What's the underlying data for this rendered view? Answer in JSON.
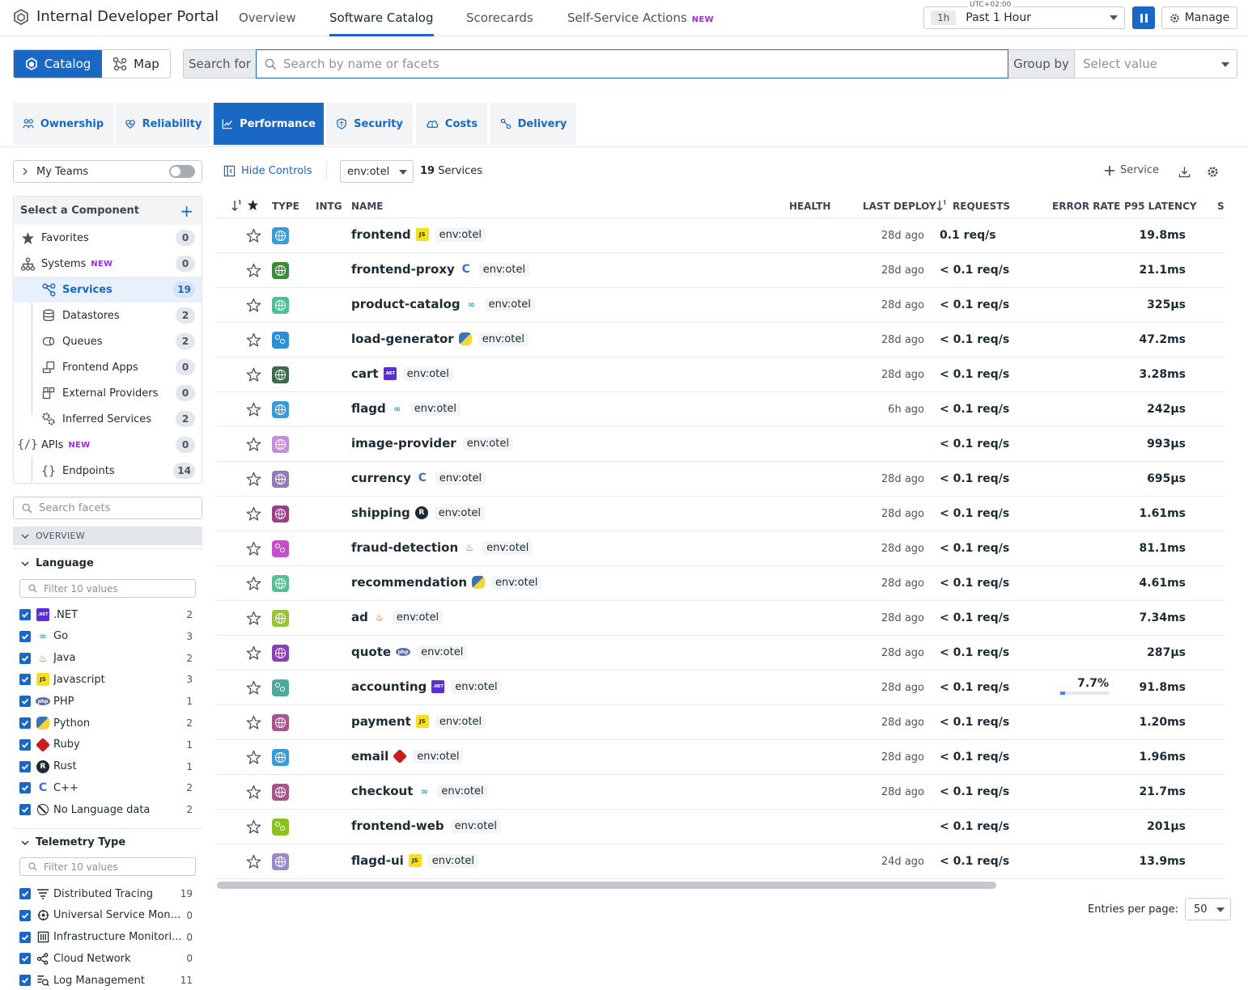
{
  "app": {
    "title": "Internal Developer Portal"
  },
  "nav": {
    "tabs": [
      {
        "label": "Overview"
      },
      {
        "label": "Software Catalog",
        "active": true
      },
      {
        "label": "Scorecards"
      },
      {
        "label": "Self-Service Actions",
        "badge": "NEW"
      }
    ],
    "timezone": "UTC+02:00",
    "time_chip": "1h",
    "time_label": "Past 1 Hour",
    "manage_label": "Manage"
  },
  "view_toggle": {
    "catalog": "Catalog",
    "map": "Map"
  },
  "search": {
    "prefix": "Search for",
    "placeholder": "Search by name or facets",
    "group_label": "Group by",
    "group_placeholder": "Select value"
  },
  "lenses": [
    {
      "label": "Ownership",
      "icon": "people-icon"
    },
    {
      "label": "Reliability",
      "icon": "heart-shield-icon"
    },
    {
      "label": "Performance",
      "icon": "line-chart-icon",
      "active": true
    },
    {
      "label": "Security",
      "icon": "shield-icon"
    },
    {
      "label": "Costs",
      "icon": "cloud-dollar-icon"
    },
    {
      "label": "Delivery",
      "icon": "pipeline-icon"
    }
  ],
  "sidebar": {
    "my_teams": "My Teams",
    "component_header": "Select a Component",
    "components": [
      {
        "label": "Favorites",
        "count": "0",
        "icon": "star-icon"
      },
      {
        "label": "Systems",
        "badge": "NEW",
        "count": "0",
        "icon": "systems-icon"
      },
      {
        "label": "Services",
        "count": "19",
        "icon": "services-icon",
        "selected": true,
        "child": true
      },
      {
        "label": "Datastores",
        "count": "2",
        "icon": "database-icon",
        "child": true
      },
      {
        "label": "Queues",
        "count": "2",
        "icon": "queue-icon",
        "child": true
      },
      {
        "label": "Frontend Apps",
        "count": "0",
        "icon": "frontend-app-icon",
        "child": true
      },
      {
        "label": "External Providers",
        "count": "0",
        "icon": "external-provider-icon",
        "child": true
      },
      {
        "label": "Inferred Services",
        "count": "2",
        "icon": "inferred-service-icon",
        "child": true
      },
      {
        "label": "APIs",
        "badge": "NEW",
        "count": "0",
        "icon": "api-icon"
      },
      {
        "label": "Endpoints",
        "count": "14",
        "icon": "braces-icon",
        "child": true
      }
    ],
    "facet_search_placeholder": "Search facets",
    "overview_label": "OVERVIEW",
    "language": {
      "title": "Language",
      "filter_placeholder": "Filter 10 values",
      "values": [
        {
          "label": ".NET",
          "count": "2",
          "badge": "net"
        },
        {
          "label": "Go",
          "count": "3",
          "badge": "go"
        },
        {
          "label": "Java",
          "count": "2",
          "badge": "java"
        },
        {
          "label": "Javascript",
          "count": "3",
          "badge": "js"
        },
        {
          "label": "PHP",
          "count": "1",
          "badge": "php"
        },
        {
          "label": "Python",
          "count": "2",
          "badge": "py"
        },
        {
          "label": "Ruby",
          "count": "1",
          "badge": "ruby"
        },
        {
          "label": "Rust",
          "count": "1",
          "badge": "rust"
        },
        {
          "label": "C++",
          "count": "2",
          "badge": "cpp"
        },
        {
          "label": "No Language data",
          "count": "2",
          "badge": "none"
        }
      ]
    },
    "telemetry": {
      "title": "Telemetry Type",
      "filter_placeholder": "Filter 10 values",
      "values": [
        {
          "label": "Distributed Tracing",
          "count": "19",
          "icon": "tracing-icon"
        },
        {
          "label": "Universal Service Monit...",
          "count": "0",
          "icon": "usm-icon"
        },
        {
          "label": "Infrastructure Monitori...",
          "count": "0",
          "icon": "infrastructure-icon"
        },
        {
          "label": "Cloud Network",
          "count": "0",
          "icon": "network-icon"
        },
        {
          "label": "Log Management",
          "count": "11",
          "icon": "logs-icon"
        }
      ]
    }
  },
  "controls": {
    "hide_controls": "Hide Controls",
    "env": "env:otel",
    "service_count": "19",
    "service_count_suffix": "Services",
    "add_service": "Service"
  },
  "table": {
    "columns": {
      "type": "TYPE",
      "intg": "INTG",
      "name": "NAME",
      "health": "HEALTH",
      "last_deploy": "LAST DEPLOY",
      "requests": "REQUESTS",
      "error_rate": "ERROR RATE",
      "p95": "P95 LATENCY",
      "cut": "SI"
    },
    "rows": [
      {
        "name": "frontend",
        "lang": "js",
        "env": "env:otel",
        "deploy": "28d ago",
        "requests": "0.1 req/s",
        "error": "",
        "latency": "19.8ms",
        "color": "#3b9bd6",
        "icon": "globe"
      },
      {
        "name": "frontend-proxy",
        "lang": "cpp",
        "env": "env:otel",
        "deploy": "28d ago",
        "requests": "< 0.1 req/s",
        "error": "",
        "latency": "21.1ms",
        "color": "#3f8a3a",
        "icon": "globe"
      },
      {
        "name": "product-catalog",
        "lang": "go",
        "env": "env:otel",
        "deploy": "28d ago",
        "requests": "< 0.1 req/s",
        "error": "",
        "latency": "325µs",
        "color": "#4fbf9a",
        "icon": "globe"
      },
      {
        "name": "load-generator",
        "lang": "py",
        "env": "env:otel",
        "deploy": "28d ago",
        "requests": "< 0.1 req/s",
        "error": "",
        "latency": "47.2ms",
        "color": "#2e8fd6",
        "icon": "cog"
      },
      {
        "name": "cart",
        "lang": "net",
        "env": "env:otel",
        "deploy": "28d ago",
        "requests": "< 0.1 req/s",
        "error": "",
        "latency": "3.28ms",
        "color": "#3e6b4c",
        "icon": "globe"
      },
      {
        "name": "flagd",
        "lang": "go",
        "env": "env:otel",
        "deploy": "6h ago",
        "requests": "< 0.1 req/s",
        "error": "",
        "latency": "242µs",
        "color": "#3b9bd6",
        "icon": "globe"
      },
      {
        "name": "image-provider",
        "lang": "",
        "env": "env:otel",
        "deploy": "",
        "requests": "< 0.1 req/s",
        "error": "",
        "latency": "993µs",
        "color": "#c48fd9",
        "icon": "globe"
      },
      {
        "name": "currency",
        "lang": "cpp",
        "env": "env:otel",
        "deploy": "28d ago",
        "requests": "< 0.1 req/s",
        "error": "",
        "latency": "695µs",
        "color": "#8f7bb8",
        "icon": "globe"
      },
      {
        "name": "shipping",
        "lang": "rust",
        "env": "env:otel",
        "deploy": "28d ago",
        "requests": "< 0.1 req/s",
        "error": "",
        "latency": "1.61ms",
        "color": "#9a3e8a",
        "icon": "globe"
      },
      {
        "name": "fraud-detection",
        "lang": "java",
        "env": "env:otel",
        "deploy": "28d ago",
        "requests": "< 0.1 req/s",
        "error": "",
        "latency": "81.1ms",
        "color": "#c44fc7",
        "icon": "cog"
      },
      {
        "name": "recommendation",
        "lang": "py",
        "env": "env:otel",
        "deploy": "28d ago",
        "requests": "< 0.1 req/s",
        "error": "",
        "latency": "4.61ms",
        "color": "#58bf96",
        "icon": "globe"
      },
      {
        "name": "ad",
        "lang": "java",
        "env": "env:otel",
        "deploy": "28d ago",
        "requests": "< 0.1 req/s",
        "error": "",
        "latency": "7.34ms",
        "color": "#9ac23a",
        "icon": "globe"
      },
      {
        "name": "quote",
        "lang": "php",
        "env": "env:otel",
        "deploy": "28d ago",
        "requests": "< 0.1 req/s",
        "error": "",
        "latency": "287µs",
        "color": "#8a3eb8",
        "icon": "globe"
      },
      {
        "name": "accounting",
        "lang": "net",
        "env": "env:otel",
        "deploy": "28d ago",
        "requests": "< 0.1 req/s",
        "error": "7.7%",
        "error_fraction": 0.1,
        "latency": "91.8ms",
        "color": "#4fa89a",
        "icon": "cog"
      },
      {
        "name": "payment",
        "lang": "js",
        "env": "env:otel",
        "deploy": "28d ago",
        "requests": "< 0.1 req/s",
        "error": "",
        "latency": "1.20ms",
        "color": "#a8558e",
        "icon": "globe"
      },
      {
        "name": "email",
        "lang": "ruby",
        "env": "env:otel",
        "deploy": "28d ago",
        "requests": "< 0.1 req/s",
        "error": "",
        "latency": "1.96ms",
        "color": "#3b9bd6",
        "icon": "globe"
      },
      {
        "name": "checkout",
        "lang": "go",
        "env": "env:otel",
        "deploy": "28d ago",
        "requests": "< 0.1 req/s",
        "error": "",
        "latency": "21.7ms",
        "color": "#a8558e",
        "icon": "globe"
      },
      {
        "name": "frontend-web",
        "lang": "",
        "env": "env:otel",
        "deploy": "",
        "requests": "< 0.1 req/s",
        "error": "",
        "latency": "201µs",
        "color": "#8ac21e",
        "icon": "cog"
      },
      {
        "name": "flagd-ui",
        "lang": "js",
        "env": "env:otel",
        "deploy": "24d ago",
        "requests": "< 0.1 req/s",
        "error": "",
        "latency": "13.9ms",
        "color": "#9a8cc8",
        "icon": "globe"
      }
    ]
  },
  "pagination": {
    "label": "Entries per page:",
    "value": "50"
  }
}
